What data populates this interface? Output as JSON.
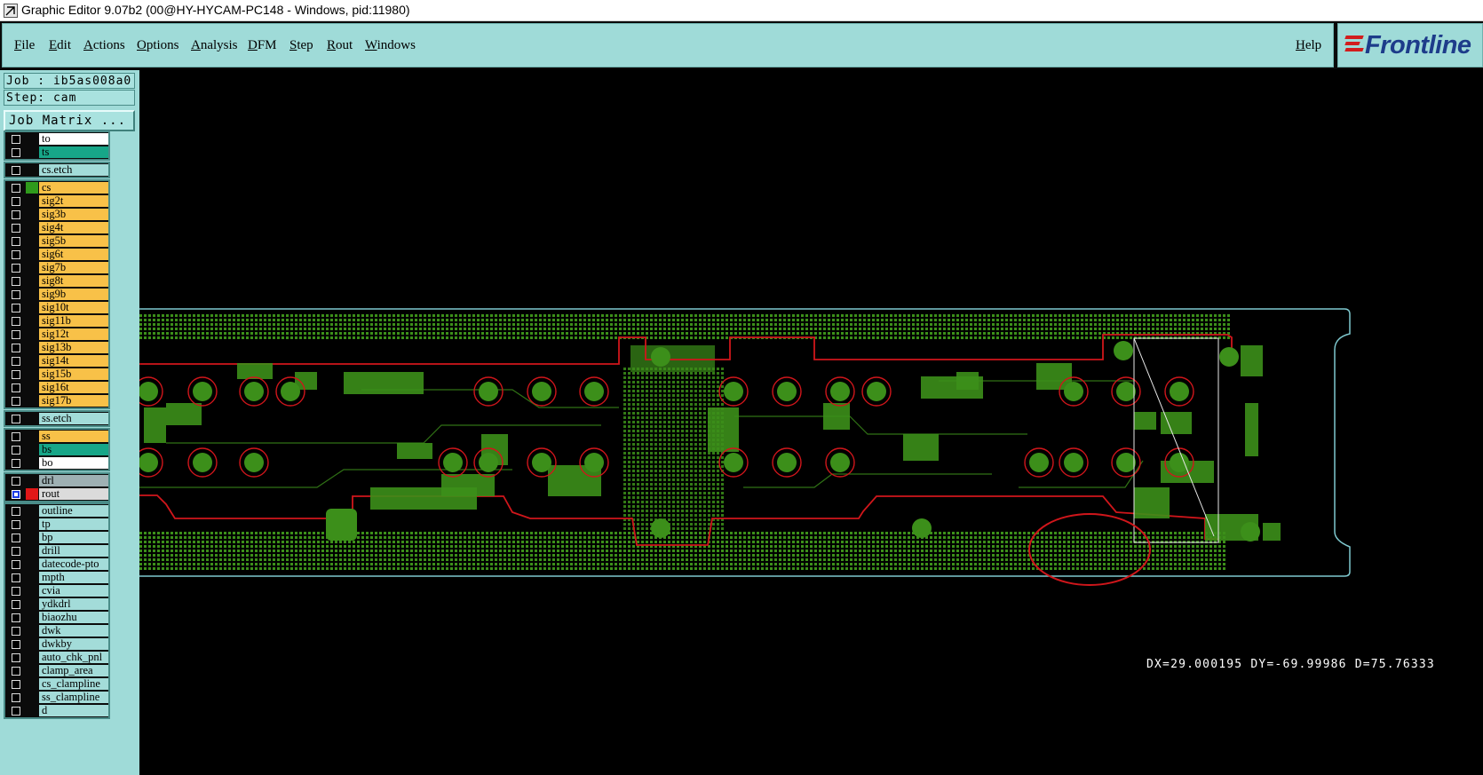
{
  "window": {
    "title": "Graphic Editor 9.07b2 (00@HY-HYCAM-PC148 - Windows, pid:11980)"
  },
  "menu": {
    "items": [
      "File",
      "Edit",
      "Actions",
      "Options",
      "Analysis",
      "DFM",
      "Step",
      "Rout",
      "Windows"
    ],
    "help": "Help"
  },
  "logo": {
    "text": "Frontline"
  },
  "job": {
    "job_label": "Job : ib5as008a0",
    "step_label": "Step: cam",
    "matrix_button": "Job Matrix ..."
  },
  "layers": [
    {
      "name": "to",
      "color": "white"
    },
    {
      "name": "ts",
      "color": "teal"
    },
    {
      "name": "cs.etch",
      "color": "cyan"
    },
    {
      "name": "cs",
      "color": "orange",
      "active": true
    },
    {
      "name": "sig2t",
      "color": "orange"
    },
    {
      "name": "sig3b",
      "color": "orange"
    },
    {
      "name": "sig4t",
      "color": "orange"
    },
    {
      "name": "sig5b",
      "color": "orange"
    },
    {
      "name": "sig6t",
      "color": "orange"
    },
    {
      "name": "sig7b",
      "color": "orange"
    },
    {
      "name": "sig8t",
      "color": "orange"
    },
    {
      "name": "sig9b",
      "color": "orange"
    },
    {
      "name": "sig10t",
      "color": "orange"
    },
    {
      "name": "sig11b",
      "color": "orange"
    },
    {
      "name": "sig12t",
      "color": "orange"
    },
    {
      "name": "sig13b",
      "color": "orange"
    },
    {
      "name": "sig14t",
      "color": "orange"
    },
    {
      "name": "sig15b",
      "color": "orange"
    },
    {
      "name": "sig16t",
      "color": "orange"
    },
    {
      "name": "sig17b",
      "color": "orange"
    },
    {
      "name": "ss.etch",
      "color": "cyan"
    },
    {
      "name": "ss",
      "color": "orange"
    },
    {
      "name": "bs",
      "color": "teal"
    },
    {
      "name": "bo",
      "color": "white"
    },
    {
      "name": "drl",
      "color": "grey"
    },
    {
      "name": "rout",
      "color": "ltgrey",
      "checked": true,
      "display": true
    },
    {
      "name": "outline",
      "color": "cyan"
    },
    {
      "name": "tp",
      "color": "cyan"
    },
    {
      "name": "bp",
      "color": "cyan"
    },
    {
      "name": "drill",
      "color": "cyan"
    },
    {
      "name": "datecode-pto",
      "color": "cyan"
    },
    {
      "name": "mpth",
      "color": "cyan"
    },
    {
      "name": "cvia",
      "color": "cyan"
    },
    {
      "name": "ydkdrl",
      "color": "cyan"
    },
    {
      "name": "biaozhu",
      "color": "cyan"
    },
    {
      "name": "dwk",
      "color": "cyan"
    },
    {
      "name": "dwkby",
      "color": "cyan"
    },
    {
      "name": "auto_chk_pnl",
      "color": "cyan"
    },
    {
      "name": "clamp_area",
      "color": "cyan"
    },
    {
      "name": "cs_clampline",
      "color": "cyan"
    },
    {
      "name": "ss_clampline",
      "color": "cyan"
    },
    {
      "name": "d",
      "color": "cyan"
    }
  ],
  "measure": {
    "readout": "DX=29.000195 DY=-69.99986 D=75.76333"
  },
  "colors": {
    "board_green": "#3c8f1a",
    "outline_cyan": "#7fc9cf",
    "rout_red": "#d0161b",
    "menu_bg": "#9fdbd8",
    "canvas_bg": "#000000"
  }
}
